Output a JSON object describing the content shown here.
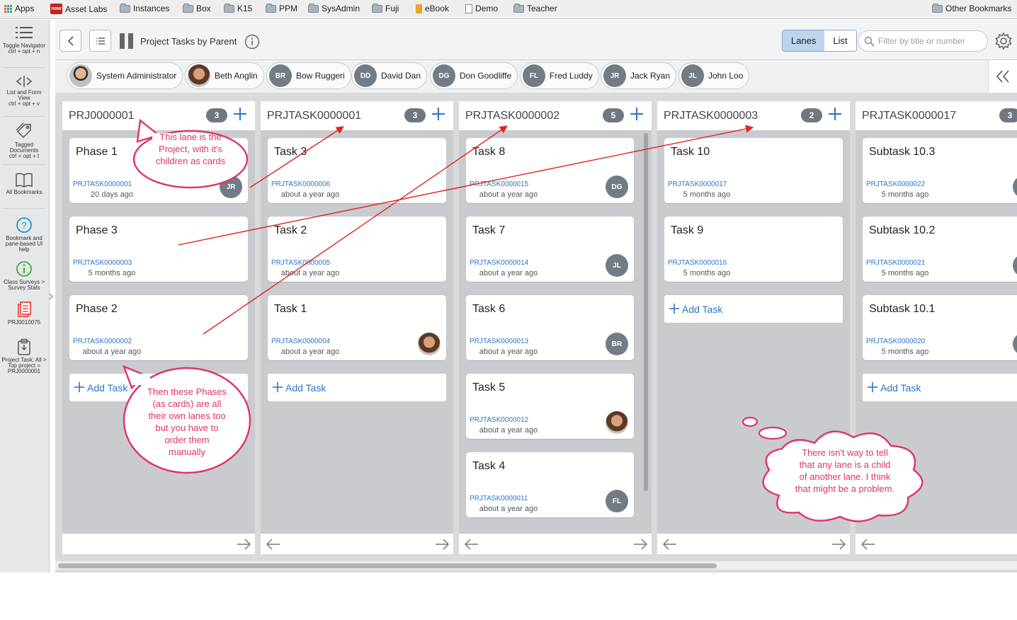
{
  "bookmarks": [
    "Apps",
    "Asset Labs",
    "Instances",
    "Box",
    "K15",
    "PPM",
    "SysAdmin",
    "Fuji",
    "eBook",
    "Demo",
    "Teacher"
  ],
  "now_badge": "now",
  "other_bookmarks": "Other Bookmarks",
  "rail": {
    "toggle_navigator": "Toggle Navigator",
    "toggle_navigator_key": "ctrl + opt + n",
    "list_form": "List and Form View",
    "list_form_key": "ctrl + opt + v",
    "tagged": "Tagged Documents",
    "tagged_key": "ctrl + opt + t",
    "all_bookmarks": "All Bookmarks",
    "help": "Bookmark and pane-based UI help",
    "surveys": "Class Surveys > Survey Stats",
    "prj": "PRJ0010075",
    "project_task": "Project Task: All > Top project = PRJ0000001"
  },
  "header": {
    "title": "Project Tasks by Parent",
    "view_lanes": "Lanes",
    "view_list": "List",
    "filter_placeholder": "Filter by title or number"
  },
  "people": [
    {
      "name": "System Administrator",
      "initials": ""
    },
    {
      "name": "Beth Anglin",
      "initials": ""
    },
    {
      "name": "Bow Ruggeri",
      "initials": "BR"
    },
    {
      "name": "David Dan",
      "initials": "DD"
    },
    {
      "name": "Don Goodliffe",
      "initials": "DG"
    },
    {
      "name": "Fred Luddy",
      "initials": "FL"
    },
    {
      "name": "Jack Ryan",
      "initials": "JR"
    },
    {
      "name": "John Loo",
      "initials": "JL"
    }
  ],
  "add_task_label": "Add Task",
  "lanes": [
    {
      "title": "PRJ0000001",
      "count": "3",
      "cards": [
        {
          "title": "Phase 1",
          "number": "PRJTASK0000001",
          "age": "20 days ago",
          "assignee": "JR"
        },
        {
          "title": "Phase 3",
          "number": "PRJTASK0000003",
          "age": "5 months ago",
          "assignee": ""
        },
        {
          "title": "Phase 2",
          "number": "PRJTASK0000002",
          "age": "about a year ago",
          "assignee": ""
        }
      ]
    },
    {
      "title": "PRJTASK0000001",
      "count": "3",
      "cards": [
        {
          "title": "Task 3",
          "number": "PRJTASK0000006",
          "age": "about a year ago",
          "assignee": ""
        },
        {
          "title": "Task 2",
          "number": "PRJTASK0000005",
          "age": "about a year ago",
          "assignee": ""
        },
        {
          "title": "Task 1",
          "number": "PRJTASK0000004",
          "age": "about a year ago",
          "assignee": ""
        }
      ]
    },
    {
      "title": "PRJTASK0000002",
      "count": "5",
      "cards": [
        {
          "title": "Task 8",
          "number": "PRJTASK0000015",
          "age": "about a year ago",
          "assignee": "DG"
        },
        {
          "title": "Task 7",
          "number": "PRJTASK0000014",
          "age": "about a year ago",
          "assignee": "JL"
        },
        {
          "title": "Task 6",
          "number": "PRJTASK0000013",
          "age": "about a year ago",
          "assignee": "BR"
        },
        {
          "title": "Task 5",
          "number": "PRJTASK0000012",
          "age": "about a year ago",
          "assignee": ""
        },
        {
          "title": "Task 4",
          "number": "PRJTASK0000011",
          "age": "about a year ago",
          "assignee": "FL"
        }
      ]
    },
    {
      "title": "PRJTASK0000003",
      "count": "2",
      "cards": [
        {
          "title": "Task 10",
          "number": "PRJTASK0000017",
          "age": "5 months ago",
          "assignee": ""
        },
        {
          "title": "Task 9",
          "number": "PRJTASK0000016",
          "age": "5 months ago",
          "assignee": ""
        }
      ]
    },
    {
      "title": "PRJTASK0000017",
      "count": "3",
      "cards": [
        {
          "title": "Subtask 10.3",
          "number": "PRJTASK0000022",
          "age": "5 months ago",
          "assignee": ""
        },
        {
          "title": "Subtask 10.2",
          "number": "PRJTASK0000021",
          "age": "5 months ago",
          "assignee": ""
        },
        {
          "title": "Subtask 10.1",
          "number": "PRJTASK0000020",
          "age": "5 months ago",
          "assignee": ""
        }
      ]
    }
  ],
  "annotations": {
    "note1": [
      "This lane is the",
      "Project, with it's",
      "children as cards"
    ],
    "note2": [
      "Then these Phases",
      "(as cards) are all",
      "their own lanes too",
      "but you have to",
      "order them",
      "manually"
    ],
    "note3": [
      "There isn't way to tell",
      "that any lane is a child",
      "of another lane. I think",
      "that might be a problem."
    ]
  },
  "colors": {
    "accent": "#2a74c9",
    "annotation": "#e0326b",
    "avatar": "#737b84",
    "lane": "#c9cbce"
  }
}
